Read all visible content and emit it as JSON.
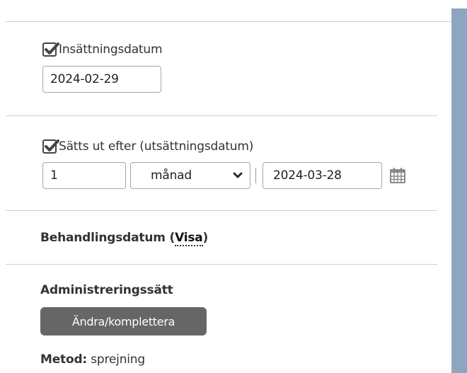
{
  "insertion": {
    "checkbox_label": "Insättningsdatum",
    "date_value": "2024-02-29",
    "checked": true
  },
  "removal": {
    "checkbox_label": "Sätts ut efter (utsättningsdatum)",
    "checked": true,
    "quantity_value": "1",
    "unit_selected": "månad",
    "date_value": "2024-03-28"
  },
  "treatment": {
    "label": "Behandlingsdatum",
    "open_paren": "(",
    "show_link": "Visa",
    "close_paren": ")"
  },
  "administration": {
    "heading": "Administreringssätt",
    "edit_button": "Ändra/komplettera",
    "method_label": "Metod:",
    "method_value": "sprejning"
  },
  "colors": {
    "scrollbar": "#8ea5bf",
    "button_bg": "#666666",
    "calendar_icon": "#8a8a8a"
  }
}
